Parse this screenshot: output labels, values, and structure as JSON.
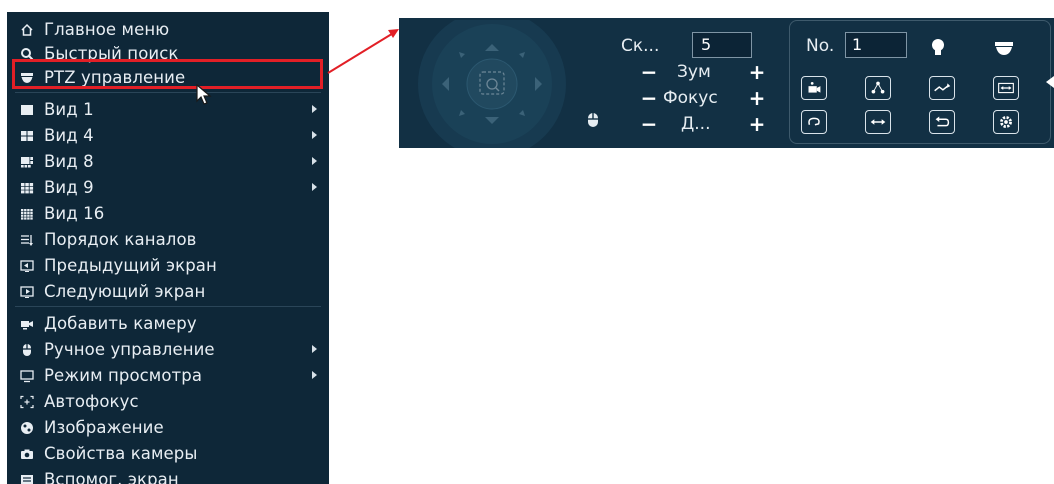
{
  "menu": {
    "items": [
      {
        "label": "Главное меню",
        "icon": "home-icon",
        "has_submenu": false
      },
      {
        "label": "Быстрый поиск",
        "icon": "search-icon",
        "has_submenu": false
      },
      {
        "label": "PTZ управление",
        "icon": "ptz-dome-icon",
        "has_submenu": false,
        "highlighted": true
      },
      {
        "label": "Вид 1",
        "icon": "view-1-icon",
        "has_submenu": true
      },
      {
        "label": "Вид 4",
        "icon": "view-4-icon",
        "has_submenu": true
      },
      {
        "label": "Вид 8",
        "icon": "view-8-icon",
        "has_submenu": true
      },
      {
        "label": "Вид 9",
        "icon": "view-9-icon",
        "has_submenu": true
      },
      {
        "label": "Вид 16",
        "icon": "view-16-icon",
        "has_submenu": false
      },
      {
        "label": "Порядок каналов",
        "icon": "channel-order-icon",
        "has_submenu": false
      },
      {
        "label": "Предыдущий экран",
        "icon": "previous-screen-icon",
        "has_submenu": false
      },
      {
        "label": "Следующий экран",
        "icon": "next-screen-icon",
        "has_submenu": false
      },
      {
        "label": "Добавить камеру",
        "icon": "add-camera-icon",
        "has_submenu": false
      },
      {
        "label": "Ручное управление",
        "icon": "mouse-icon",
        "has_submenu": true
      },
      {
        "label": "Режим просмотра",
        "icon": "monitor-icon",
        "has_submenu": true
      },
      {
        "label": "Автофокус",
        "icon": "autofocus-icon",
        "has_submenu": false
      },
      {
        "label": "Изображение",
        "icon": "image-icon",
        "has_submenu": false
      },
      {
        "label": "Свойства камеры",
        "icon": "camera-icon",
        "has_submenu": false
      },
      {
        "label": "Вспомог. экран",
        "icon": "aux-screen-icon",
        "has_submenu": false
      }
    ]
  },
  "ptz": {
    "speed_label": "Ск...",
    "speed_value": "5",
    "zoom_label": "Зум",
    "focus_label": "Фокус",
    "iris_label": "Д...",
    "minus": "−",
    "plus": "+",
    "no_label": "No.",
    "no_value": "1"
  },
  "colors": {
    "menu_bg": "#0e2738",
    "panel_bg": "#123044",
    "highlight": "#e21f26",
    "text": "#e8eef3"
  }
}
